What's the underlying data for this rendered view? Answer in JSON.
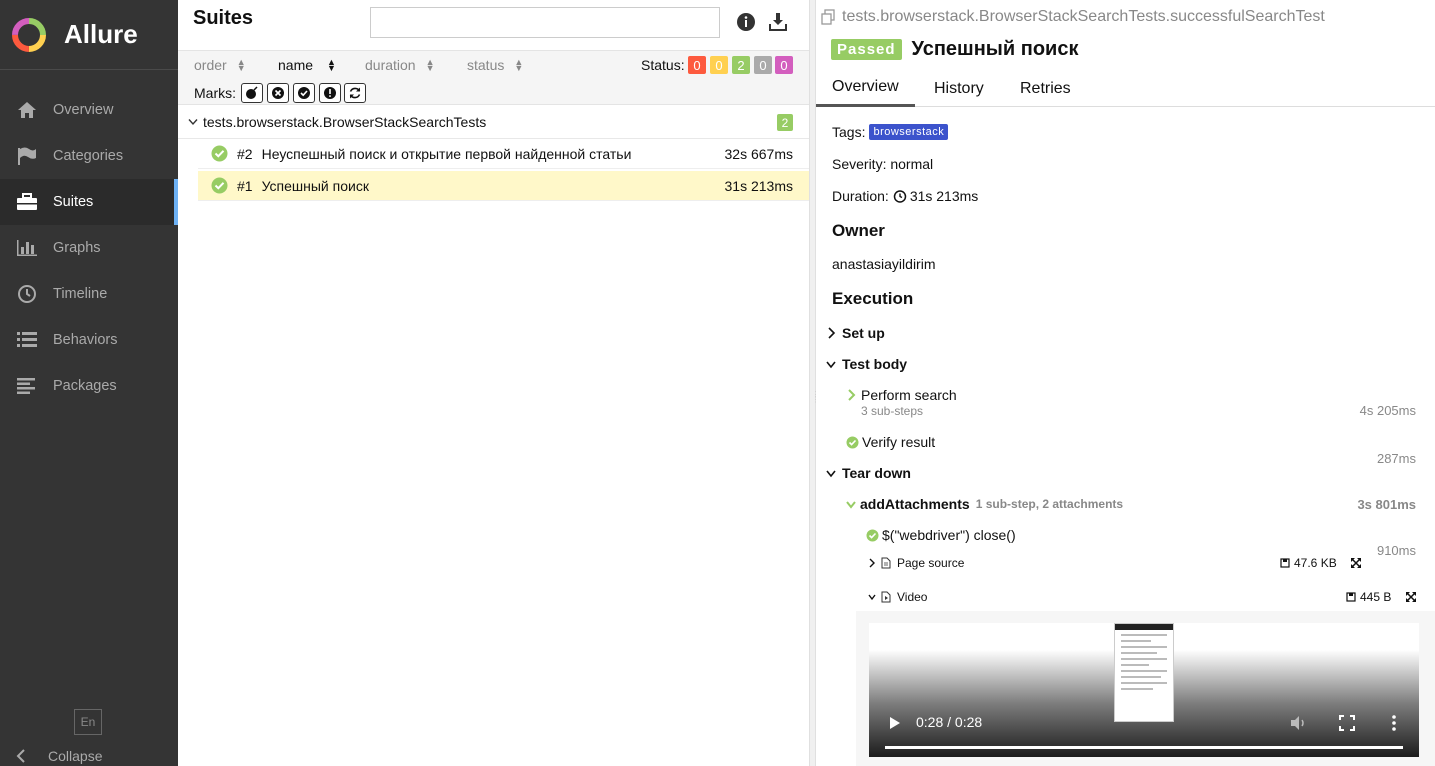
{
  "sidebar": {
    "brand": "Allure",
    "items": [
      {
        "label": "Overview",
        "icon": "home-icon"
      },
      {
        "label": "Categories",
        "icon": "flag-icon"
      },
      {
        "label": "Suites",
        "icon": "briefcase-icon"
      },
      {
        "label": "Graphs",
        "icon": "bar-chart-icon"
      },
      {
        "label": "Timeline",
        "icon": "clock-icon"
      },
      {
        "label": "Behaviors",
        "icon": "list-icon"
      },
      {
        "label": "Packages",
        "icon": "align-left-icon"
      }
    ],
    "active": "Suites",
    "lang": "En",
    "collapse": "Collapse"
  },
  "suites": {
    "title": "Suites",
    "search_value": "",
    "sort": {
      "order": "order",
      "name": "name",
      "duration": "duration",
      "status": "status"
    },
    "status_label": "Status:",
    "status_counts": [
      {
        "value": "0",
        "color": "#fd5a3e"
      },
      {
        "value": "0",
        "color": "#ffd050"
      },
      {
        "value": "2",
        "color": "#97cc64"
      },
      {
        "value": "0",
        "color": "#aaaaaa"
      },
      {
        "value": "0",
        "color": "#d35ebe"
      }
    ],
    "marks_label": "Marks:",
    "group": {
      "name": "tests.browserstack.BrowserStackSearchTests",
      "count": "2"
    },
    "tests": [
      {
        "num": "#2",
        "name": "Неуспешный поиск и открытие первой найденной статьи",
        "duration": "32s 667ms"
      },
      {
        "num": "#1",
        "name": "Успешный поиск",
        "duration": "31s 213ms"
      }
    ]
  },
  "detail": {
    "fullname": "tests.browserstack.BrowserStackSearchTests.successfulSearchTest",
    "status": "Passed",
    "title": "Успешный поиск",
    "tabs": [
      "Overview",
      "History",
      "Retries"
    ],
    "tags_label": "Tags:",
    "tag": "browserstack",
    "severity": "Severity: normal",
    "duration_label": "Duration:",
    "duration": "31s 213ms",
    "owner_h": "Owner",
    "owner": "anastasiayildirim",
    "execution_h": "Execution",
    "setup": "Set up",
    "test_body": "Test body",
    "perform_search": "Perform search",
    "perform_sub": "3 sub-steps",
    "perform_time": "4s 205ms",
    "verify": "Verify result",
    "verify_time": "287ms",
    "teardown": "Tear down",
    "add_attach": "addAttachments",
    "add_attach_meta": "1 sub-step, 2 attachments",
    "add_attach_time": "3s 801ms",
    "webdriver": "$(\"webdriver\") close()",
    "webdriver_time": "910ms",
    "page_source": "Page source",
    "page_source_size": "47.6 KB",
    "video": "Video",
    "video_size": "445 B",
    "video_time": "0:28 / 0:28"
  }
}
